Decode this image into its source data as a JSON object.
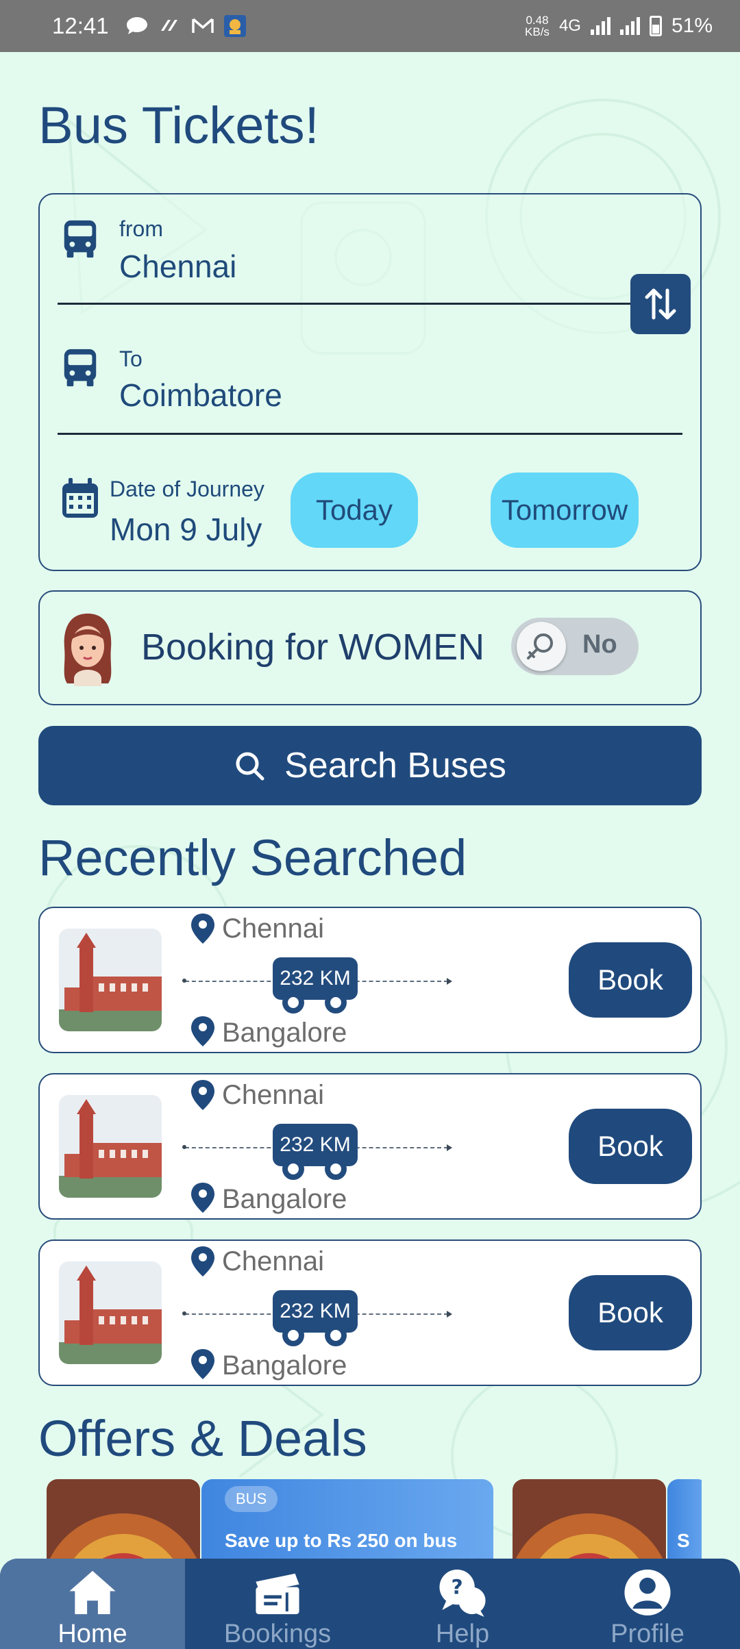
{
  "status_bar": {
    "time": "12:41",
    "net_speed_value": "0.48",
    "net_speed_unit": "KB/s",
    "network": "4G",
    "battery": "51%",
    "icons": [
      "chat-bubble-icon",
      "swirl-app-icon",
      "gmail-icon",
      "app-avatar-icon",
      "wifi-signal-icon",
      "cell-signal-icon",
      "battery-icon"
    ]
  },
  "page": {
    "title": "Bus Tickets!"
  },
  "search_form": {
    "from_label": "from",
    "from_value": "Chennai",
    "to_label": "To",
    "to_value": "Coimbatore",
    "date_label": "Date of Journey",
    "date_value": "Mon 9 July",
    "today_label": "Today",
    "tomorrow_label": "Tomorrow"
  },
  "women_booking": {
    "label": "Booking for WOMEN",
    "toggle_label": "No"
  },
  "search_button": {
    "label": "Search Buses"
  },
  "recent": {
    "title": "Recently Searched",
    "items": [
      {
        "from": "Chennai",
        "to": "Bangalore",
        "distance": "232 KM",
        "book_label": "Book"
      },
      {
        "from": "Chennai",
        "to": "Bangalore",
        "distance": "232 KM",
        "book_label": "Book"
      },
      {
        "from": "Chennai",
        "to": "Bangalore",
        "distance": "232 KM",
        "book_label": "Book"
      }
    ]
  },
  "offers": {
    "title": "Offers & Deals",
    "items": [
      {
        "tag": "BUS",
        "text": "Save up to Rs 250 on bus"
      },
      {
        "tag": "",
        "text": "S"
      }
    ]
  },
  "nav": {
    "items": [
      {
        "label": "Home",
        "active": true
      },
      {
        "label": "Bookings",
        "active": false
      },
      {
        "label": "Help",
        "active": false
      },
      {
        "label": "Profile",
        "active": false
      }
    ]
  },
  "colors": {
    "primary": "#204a7d",
    "accent_pill": "#62d7f8",
    "background": "#e3fbef",
    "nav_active": "#4f73a0"
  }
}
